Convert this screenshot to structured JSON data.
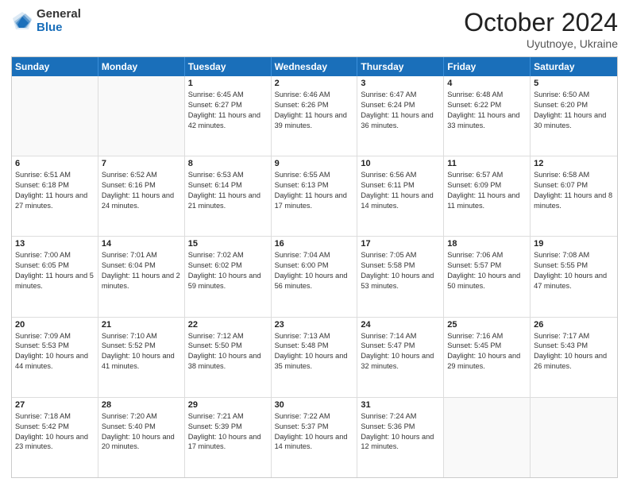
{
  "header": {
    "logo_general": "General",
    "logo_blue": "Blue",
    "month_title": "October 2024",
    "location": "Uyutnoye, Ukraine"
  },
  "days_of_week": [
    "Sunday",
    "Monday",
    "Tuesday",
    "Wednesday",
    "Thursday",
    "Friday",
    "Saturday"
  ],
  "weeks": [
    [
      {
        "day": "",
        "sunrise": "",
        "sunset": "",
        "daylight": ""
      },
      {
        "day": "",
        "sunrise": "",
        "sunset": "",
        "daylight": ""
      },
      {
        "day": "1",
        "sunrise": "Sunrise: 6:45 AM",
        "sunset": "Sunset: 6:27 PM",
        "daylight": "Daylight: 11 hours and 42 minutes."
      },
      {
        "day": "2",
        "sunrise": "Sunrise: 6:46 AM",
        "sunset": "Sunset: 6:26 PM",
        "daylight": "Daylight: 11 hours and 39 minutes."
      },
      {
        "day": "3",
        "sunrise": "Sunrise: 6:47 AM",
        "sunset": "Sunset: 6:24 PM",
        "daylight": "Daylight: 11 hours and 36 minutes."
      },
      {
        "day": "4",
        "sunrise": "Sunrise: 6:48 AM",
        "sunset": "Sunset: 6:22 PM",
        "daylight": "Daylight: 11 hours and 33 minutes."
      },
      {
        "day": "5",
        "sunrise": "Sunrise: 6:50 AM",
        "sunset": "Sunset: 6:20 PM",
        "daylight": "Daylight: 11 hours and 30 minutes."
      }
    ],
    [
      {
        "day": "6",
        "sunrise": "Sunrise: 6:51 AM",
        "sunset": "Sunset: 6:18 PM",
        "daylight": "Daylight: 11 hours and 27 minutes."
      },
      {
        "day": "7",
        "sunrise": "Sunrise: 6:52 AM",
        "sunset": "Sunset: 6:16 PM",
        "daylight": "Daylight: 11 hours and 24 minutes."
      },
      {
        "day": "8",
        "sunrise": "Sunrise: 6:53 AM",
        "sunset": "Sunset: 6:14 PM",
        "daylight": "Daylight: 11 hours and 21 minutes."
      },
      {
        "day": "9",
        "sunrise": "Sunrise: 6:55 AM",
        "sunset": "Sunset: 6:13 PM",
        "daylight": "Daylight: 11 hours and 17 minutes."
      },
      {
        "day": "10",
        "sunrise": "Sunrise: 6:56 AM",
        "sunset": "Sunset: 6:11 PM",
        "daylight": "Daylight: 11 hours and 14 minutes."
      },
      {
        "day": "11",
        "sunrise": "Sunrise: 6:57 AM",
        "sunset": "Sunset: 6:09 PM",
        "daylight": "Daylight: 11 hours and 11 minutes."
      },
      {
        "day": "12",
        "sunrise": "Sunrise: 6:58 AM",
        "sunset": "Sunset: 6:07 PM",
        "daylight": "Daylight: 11 hours and 8 minutes."
      }
    ],
    [
      {
        "day": "13",
        "sunrise": "Sunrise: 7:00 AM",
        "sunset": "Sunset: 6:05 PM",
        "daylight": "Daylight: 11 hours and 5 minutes."
      },
      {
        "day": "14",
        "sunrise": "Sunrise: 7:01 AM",
        "sunset": "Sunset: 6:04 PM",
        "daylight": "Daylight: 11 hours and 2 minutes."
      },
      {
        "day": "15",
        "sunrise": "Sunrise: 7:02 AM",
        "sunset": "Sunset: 6:02 PM",
        "daylight": "Daylight: 10 hours and 59 minutes."
      },
      {
        "day": "16",
        "sunrise": "Sunrise: 7:04 AM",
        "sunset": "Sunset: 6:00 PM",
        "daylight": "Daylight: 10 hours and 56 minutes."
      },
      {
        "day": "17",
        "sunrise": "Sunrise: 7:05 AM",
        "sunset": "Sunset: 5:58 PM",
        "daylight": "Daylight: 10 hours and 53 minutes."
      },
      {
        "day": "18",
        "sunrise": "Sunrise: 7:06 AM",
        "sunset": "Sunset: 5:57 PM",
        "daylight": "Daylight: 10 hours and 50 minutes."
      },
      {
        "day": "19",
        "sunrise": "Sunrise: 7:08 AM",
        "sunset": "Sunset: 5:55 PM",
        "daylight": "Daylight: 10 hours and 47 minutes."
      }
    ],
    [
      {
        "day": "20",
        "sunrise": "Sunrise: 7:09 AM",
        "sunset": "Sunset: 5:53 PM",
        "daylight": "Daylight: 10 hours and 44 minutes."
      },
      {
        "day": "21",
        "sunrise": "Sunrise: 7:10 AM",
        "sunset": "Sunset: 5:52 PM",
        "daylight": "Daylight: 10 hours and 41 minutes."
      },
      {
        "day": "22",
        "sunrise": "Sunrise: 7:12 AM",
        "sunset": "Sunset: 5:50 PM",
        "daylight": "Daylight: 10 hours and 38 minutes."
      },
      {
        "day": "23",
        "sunrise": "Sunrise: 7:13 AM",
        "sunset": "Sunset: 5:48 PM",
        "daylight": "Daylight: 10 hours and 35 minutes."
      },
      {
        "day": "24",
        "sunrise": "Sunrise: 7:14 AM",
        "sunset": "Sunset: 5:47 PM",
        "daylight": "Daylight: 10 hours and 32 minutes."
      },
      {
        "day": "25",
        "sunrise": "Sunrise: 7:16 AM",
        "sunset": "Sunset: 5:45 PM",
        "daylight": "Daylight: 10 hours and 29 minutes."
      },
      {
        "day": "26",
        "sunrise": "Sunrise: 7:17 AM",
        "sunset": "Sunset: 5:43 PM",
        "daylight": "Daylight: 10 hours and 26 minutes."
      }
    ],
    [
      {
        "day": "27",
        "sunrise": "Sunrise: 7:18 AM",
        "sunset": "Sunset: 5:42 PM",
        "daylight": "Daylight: 10 hours and 23 minutes."
      },
      {
        "day": "28",
        "sunrise": "Sunrise: 7:20 AM",
        "sunset": "Sunset: 5:40 PM",
        "daylight": "Daylight: 10 hours and 20 minutes."
      },
      {
        "day": "29",
        "sunrise": "Sunrise: 7:21 AM",
        "sunset": "Sunset: 5:39 PM",
        "daylight": "Daylight: 10 hours and 17 minutes."
      },
      {
        "day": "30",
        "sunrise": "Sunrise: 7:22 AM",
        "sunset": "Sunset: 5:37 PM",
        "daylight": "Daylight: 10 hours and 14 minutes."
      },
      {
        "day": "31",
        "sunrise": "Sunrise: 7:24 AM",
        "sunset": "Sunset: 5:36 PM",
        "daylight": "Daylight: 10 hours and 12 minutes."
      },
      {
        "day": "",
        "sunrise": "",
        "sunset": "",
        "daylight": ""
      },
      {
        "day": "",
        "sunrise": "",
        "sunset": "",
        "daylight": ""
      }
    ]
  ]
}
